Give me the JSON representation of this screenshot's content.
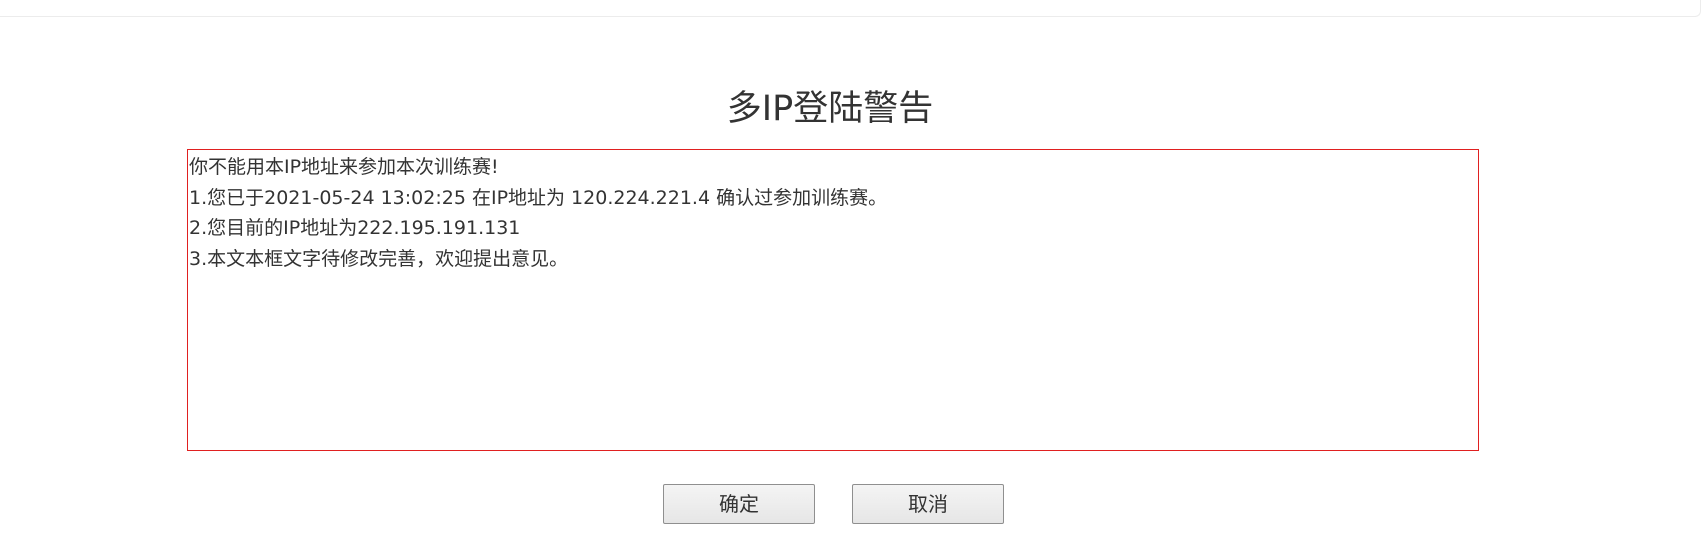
{
  "dialog": {
    "title": "多IP登陆警告",
    "message_lines": [
      "你不能用本IP地址来参加本次训练赛!",
      "1.您已于2021-05-24 13:02:25 在IP地址为 120.224.221.4 确认过参加训练赛。",
      "2.您目前的IP地址为222.195.191.131",
      "3.本文本框文字待修改完善，欢迎提出意见。"
    ],
    "confirm_label": "确定",
    "cancel_label": "取消"
  },
  "colors": {
    "box_border": "#e02020",
    "text": "#333333",
    "button_border": "#8f8f8f"
  }
}
